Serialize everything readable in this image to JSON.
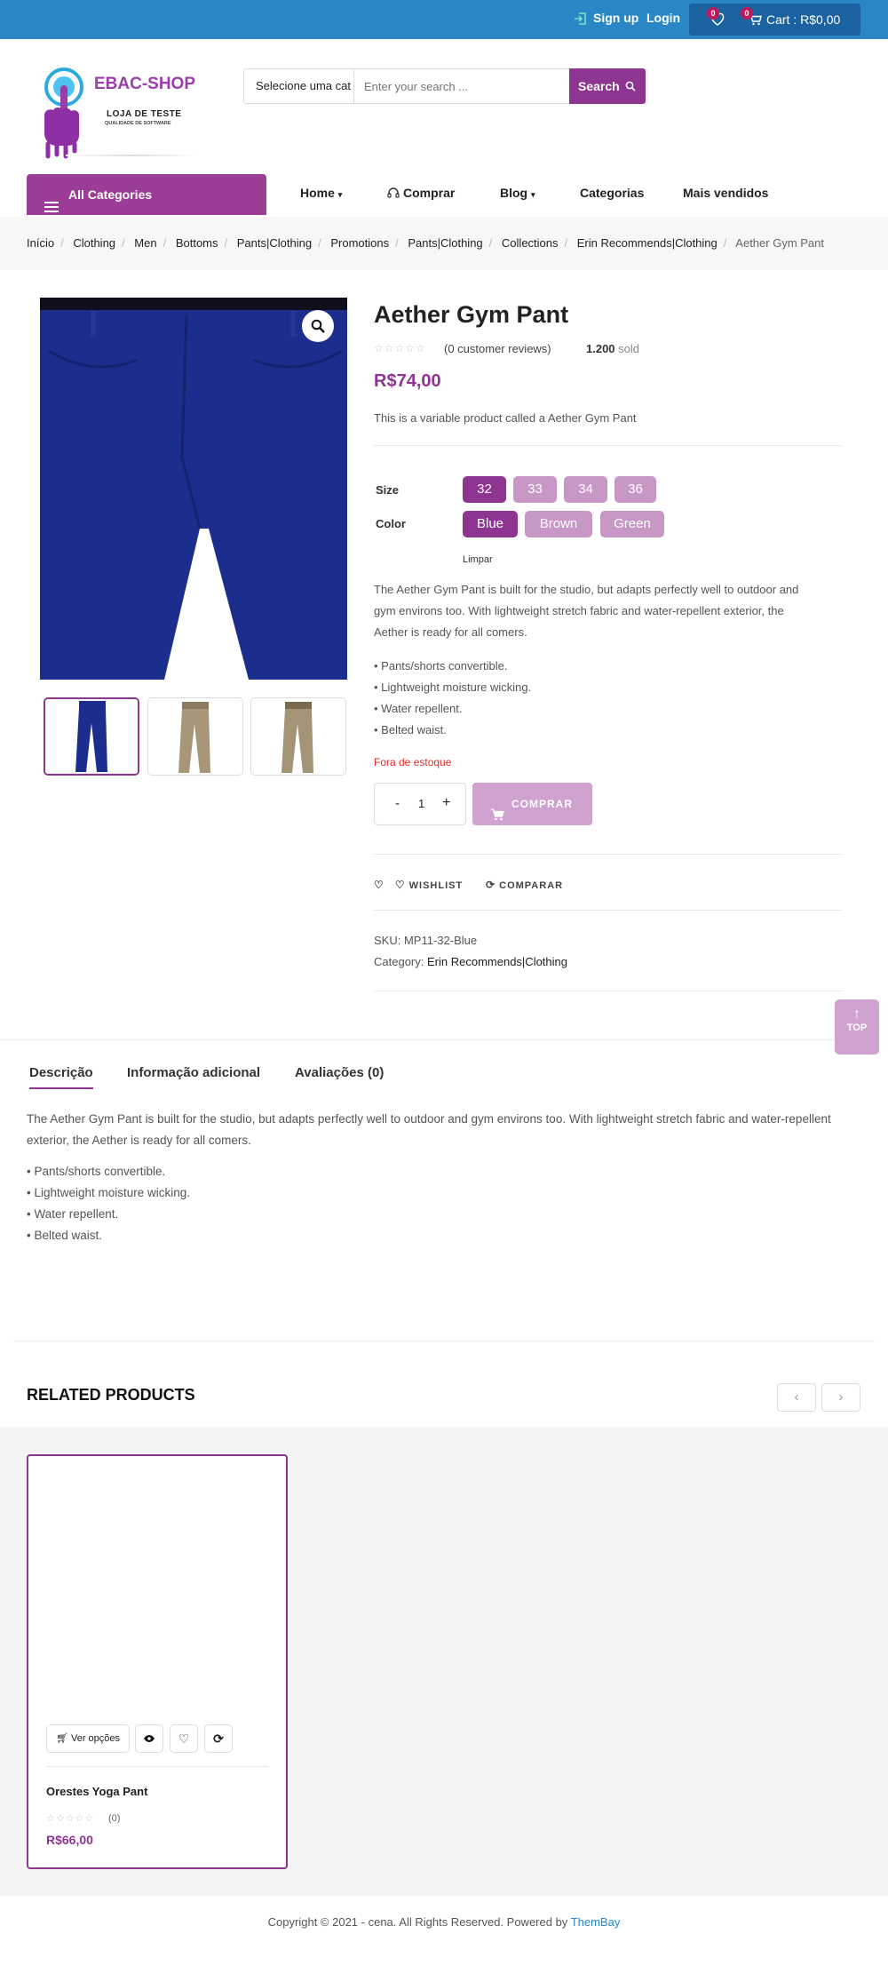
{
  "topbar": {
    "signup": "Sign up",
    "login": "Login",
    "wishlist_count": "0",
    "cart_count": "0",
    "cart_label": "Cart : R$0,00"
  },
  "logo": {
    "brand": "EBAC-SHOP",
    "line1": "LOJA DE TESTE",
    "line2": "QUALIDADE DE SOFTWARE"
  },
  "search": {
    "category": "Selecione uma cat",
    "placeholder": "Enter your search ...",
    "button": "Search"
  },
  "nav": {
    "all_categories": "All Categories",
    "items": [
      "Home",
      "Comprar",
      "Blog",
      "Categorias",
      "Mais vendidos"
    ]
  },
  "breadcrumb": [
    "Início",
    "Clothing",
    "Men",
    "Bottoms",
    "Pants|Clothing",
    "Promotions",
    "Pants|Clothing",
    "Collections",
    "Erin Recommends|Clothing",
    "Aether Gym Pant"
  ],
  "product": {
    "title": "Aether Gym Pant",
    "reviews": "(0 customer reviews)",
    "sold_count": "1.200",
    "sold_label": "sold",
    "price": "R$74,00",
    "short_desc": "This is a variable product called a Aether Gym Pant",
    "size_label": "Size",
    "sizes": [
      "32",
      "33",
      "34",
      "36"
    ],
    "color_label": "Color",
    "colors": [
      "Blue",
      "Brown",
      "Green"
    ],
    "clear": "Limpar",
    "long_desc_1": "The Aether Gym Pant is built for the studio, but adapts perfectly well to outdoor and",
    "long_desc_2": "gym environs too. With lightweight stretch fabric and water-repellent exterior, the",
    "long_desc_3": "Aether is ready for all comers.",
    "bullets": [
      "• Pants/shorts convertible.",
      "• Lightweight moisture wicking.",
      "• Water repellent.",
      "• Belted waist."
    ],
    "stock": "Fora de estoque",
    "qty_minus": "-",
    "qty": "1",
    "qty_plus": "+",
    "buy": "COMPRAR",
    "wishlist": "WISHLIST",
    "compare": "COMPARAR",
    "sku_label": "SKU:",
    "sku": "MP11-32-Blue",
    "category_label": "Category:",
    "category": "Erin Recommends|Clothing"
  },
  "top_button": "TOP",
  "tabs": [
    "Descrição",
    "Informação adicional",
    "Avaliações (0)"
  ],
  "description": {
    "line1": "The Aether Gym Pant is built for the studio, but adapts perfectly well to outdoor and gym environs too. With lightweight stretch fabric and water-repellent",
    "line2": "exterior, the Aether is ready for all comers.",
    "bullets": [
      "• Pants/shorts convertible.",
      "• Lightweight moisture wicking.",
      "• Water repellent.",
      "• Belted waist."
    ]
  },
  "related": {
    "title": "RELATED PRODUCTS",
    "prev": "‹",
    "next": "›",
    "card": {
      "options": "Ver opções",
      "name": "Orestes Yoga Pant",
      "reviews": "(0)",
      "price": "R$66,00"
    }
  },
  "footer": {
    "text": "Copyright © 2021 - cena. All Rights Reserved. Powered by ",
    "link": "ThemBay"
  },
  "colors": {
    "topbar": "#2a87c5",
    "accent": "#8e3591",
    "accent_light": "#c798c6",
    "stock": "#e02b27"
  },
  "icons": [
    "signup-icon",
    "heart-icon",
    "cart-icon",
    "search-icon",
    "menu-icon",
    "headset-icon",
    "zoom-icon",
    "compare-icon",
    "eye-icon",
    "arrow-up-icon"
  ]
}
